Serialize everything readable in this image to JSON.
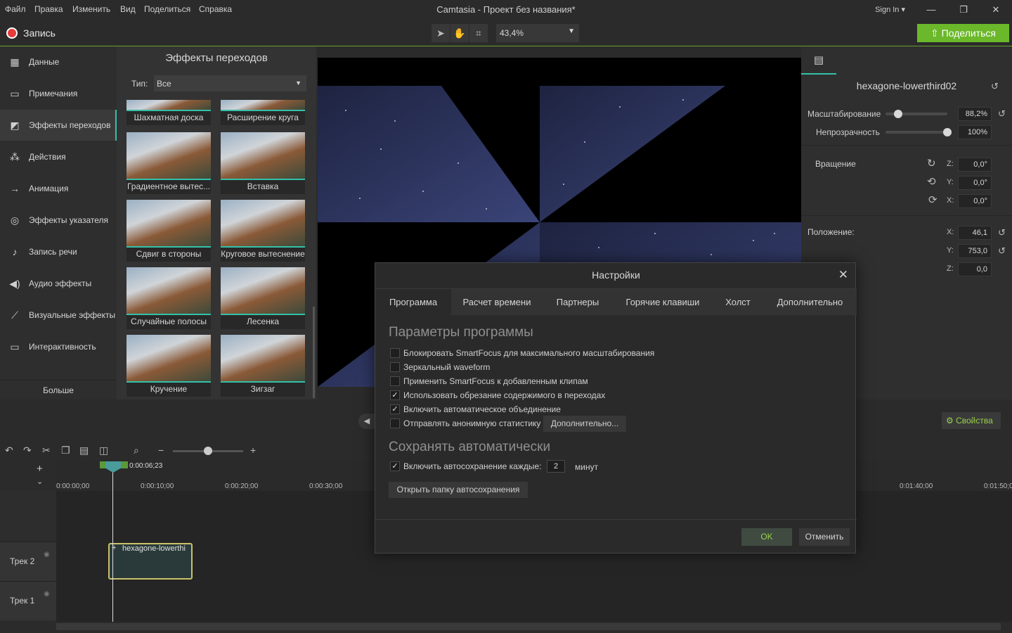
{
  "menu": [
    "Файл",
    "Правка",
    "Изменить",
    "Вид",
    "Поделиться",
    "Справка"
  ],
  "app_title": "Camtasia - Проект без названия*",
  "signin": "Sign In ▾",
  "window_buttons": {
    "minimize": "—",
    "maximize": "❐",
    "close": "✕"
  },
  "toolbar": {
    "record_label": "Запись",
    "zoom": "43,4%",
    "share_label": "Поделиться"
  },
  "sidebar": {
    "items": [
      {
        "label": "Данные",
        "icon": "film-icon"
      },
      {
        "label": "Примечания",
        "icon": "annotation-icon"
      },
      {
        "label": "Эффекты переходов",
        "icon": "transition-icon"
      },
      {
        "label": "Действия",
        "icon": "behaviors-icon"
      },
      {
        "label": "Анимация",
        "icon": "animation-icon"
      },
      {
        "label": "Эффекты указателя",
        "icon": "cursor-icon"
      },
      {
        "label": "Запись речи",
        "icon": "microphone-icon"
      },
      {
        "label": "Аудио эффекты",
        "icon": "speaker-icon"
      },
      {
        "label": "Визуальные эффекты",
        "icon": "wand-icon"
      },
      {
        "label": "Интерактивность",
        "icon": "interactivity-icon"
      }
    ],
    "more": "Больше"
  },
  "effects": {
    "title": "Эффекты переходов",
    "type_label": "Тип:",
    "type_value": "Все",
    "items": [
      "Шахматная доска",
      "Расширение круга",
      "Градиентное вытес...",
      "Вставка",
      "Сдвиг в стороны",
      "Круговое вытеснение",
      "Случайные полосы",
      "Лесенка",
      "Кручение",
      "Зигзаг"
    ]
  },
  "props": {
    "clip_name": "hexagone-lowerthird02",
    "scale_label": "Масштабирование",
    "scale_value": "88,2%",
    "scale_level": 0.2,
    "opacity_label": "Непрозрачность",
    "opacity_value": "100%",
    "opacity_level": 1.0,
    "rotation_label": "Вращение",
    "rot_z": "0,0°",
    "rot_y": "0,0°",
    "rot_x": "0,0°",
    "position_label": "Положение:",
    "pos_x": "46,1",
    "pos_y": "753,0",
    "pos_z": "0,0",
    "axis_z": "Z:",
    "axis_y": "Y:",
    "axis_x": "X:"
  },
  "timeline": {
    "properties_button": "Свойства",
    "playhead_time": "0:00:06;23",
    "ticks": [
      "0:00:00;00",
      "0:00:10;00",
      "0:00:20;00",
      "0:00:30;00",
      "0:01:40;00",
      "0:01:50;0"
    ],
    "tracks": [
      "Трек 2",
      "Трек 1"
    ],
    "clip_label": "hexagone-lowerthi"
  },
  "dialog": {
    "title": "Настройки",
    "tabs": [
      "Программа",
      "Расчет времени",
      "Партнеры",
      "Горячие клавиши",
      "Холст",
      "Дополнительно"
    ],
    "section1": "Параметры программы",
    "options": [
      {
        "label": "Блокировать SmartFocus для максимального масштабирования",
        "checked": false
      },
      {
        "label": "Зеркальный waveform",
        "checked": false
      },
      {
        "label": "Применить SmartFocus к добавленным клипам",
        "checked": false
      },
      {
        "label": "Использовать обрезание содержимого в переходах",
        "checked": true
      },
      {
        "label": "Включить автоматическое объединение",
        "checked": true
      },
      {
        "label": "Отправлять анонимную статистику",
        "checked": false
      }
    ],
    "more_button": "Дополнительно...",
    "section2": "Сохранять автоматически",
    "autosave_label": "Включить автосохранение каждые:",
    "autosave_checked": true,
    "autosave_value": "2",
    "autosave_unit": "минут",
    "open_folder": "Открыть папку автосохранения",
    "ok": "OK",
    "cancel": "Отменить"
  },
  "colors": {
    "accent": "#34c0a8",
    "share": "#6bb82a",
    "record": "#e53b3b"
  }
}
